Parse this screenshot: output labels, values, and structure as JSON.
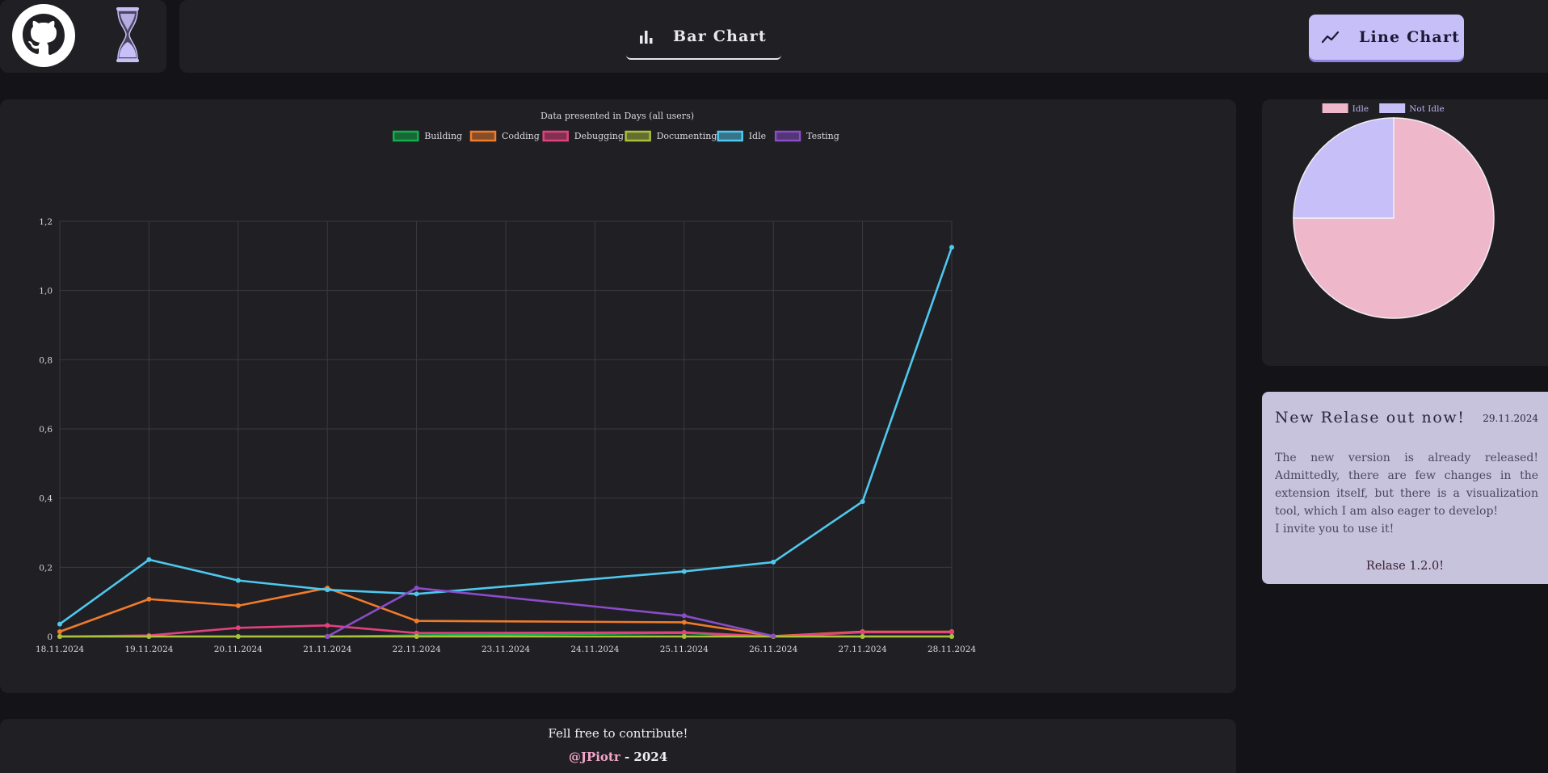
{
  "header": {
    "github_icon": "github-icon",
    "hourglass_icon": "hourglass-icon",
    "tabs": [
      {
        "label": "Bar Chart",
        "icon": "bar-chart-icon",
        "active": false
      },
      {
        "label": "Line Chart",
        "icon": "line-chart-icon",
        "active": true
      }
    ]
  },
  "colors": {
    "building": "#10b04a",
    "codding": "#f07b2a",
    "debugging": "#e2417e",
    "documenting": "#a9c03a",
    "idle": "#4fc8ee",
    "testing": "#8a4cc8",
    "pie_idle": "#eeb8ca",
    "pie_not_idle": "#c7bff8",
    "accent": "#c7bff8"
  },
  "chart_data": [
    {
      "type": "line",
      "title": "Data presented in Days (all users)",
      "categories": [
        "18.11.2024",
        "19.11.2024",
        "20.11.2024",
        "21.11.2024",
        "22.11.2024",
        "23.11.2024",
        "24.11.2024",
        "25.11.2024",
        "26.11.2024",
        "27.11.2024",
        "28.11.2024"
      ],
      "ylim": [
        0,
        1.2
      ],
      "yticks": [
        "0",
        "0,2",
        "0,4",
        "0,6",
        "0,8",
        "1,0",
        "1,2"
      ],
      "grid": true,
      "legend_position": "top",
      "series": [
        {
          "name": "Building",
          "color": "#10b04a",
          "points": [
            [
              0,
              0
            ],
            [
              1,
              0
            ],
            [
              2,
              0
            ],
            [
              3,
              0
            ],
            [
              4,
              0.003
            ],
            [
              7,
              0.01
            ],
            [
              8,
              0
            ],
            [
              9,
              0
            ],
            [
              10,
              0
            ]
          ]
        },
        {
          "name": "Codding",
          "color": "#f07b2a",
          "points": [
            [
              0,
              0.014
            ],
            [
              1,
              0.108
            ],
            [
              2,
              0.089
            ],
            [
              3,
              0.14
            ],
            [
              4,
              0.045
            ],
            [
              7,
              0.041
            ],
            [
              8,
              0.001
            ],
            [
              9,
              0.014
            ],
            [
              10,
              0.014
            ]
          ]
        },
        {
          "name": "Debugging",
          "color": "#e2417e",
          "points": [
            [
              0,
              0
            ],
            [
              1,
              0.003
            ],
            [
              2,
              0.025
            ],
            [
              3,
              0.032
            ],
            [
              4,
              0.01
            ],
            [
              7,
              0.012
            ],
            [
              8,
              0
            ],
            [
              9,
              0.012
            ],
            [
              10,
              0.012
            ]
          ]
        },
        {
          "name": "Documenting",
          "color": "#a9c03a",
          "points": [
            [
              0,
              0
            ],
            [
              1,
              0
            ],
            [
              2,
              0
            ],
            [
              3,
              0
            ],
            [
              4,
              0
            ],
            [
              7,
              0
            ],
            [
              8,
              0
            ],
            [
              9,
              0
            ],
            [
              10,
              0
            ]
          ]
        },
        {
          "name": "Idle",
          "color": "#4fc8ee",
          "points": [
            [
              0,
              0.036
            ],
            [
              1,
              0.222
            ],
            [
              2,
              0.162
            ],
            [
              3,
              0.135
            ],
            [
              4,
              0.123
            ],
            [
              7,
              0.188
            ],
            [
              8,
              0.215
            ],
            [
              9,
              0.39
            ],
            [
              10,
              1.125
            ]
          ]
        },
        {
          "name": "Testing",
          "color": "#8a4cc8",
          "points": [
            [
              3,
              0
            ],
            [
              4,
              0.14
            ],
            [
              7,
              0.06
            ],
            [
              8,
              0.001
            ]
          ]
        }
      ]
    },
    {
      "type": "pie",
      "labels": [
        "Idle",
        "Not Idle"
      ],
      "values": [
        75,
        25
      ],
      "colors": [
        "#eeb8ca",
        "#c7bff8"
      ],
      "legend_position": "top"
    }
  ],
  "release": {
    "title": "New Relase out now!",
    "date": "29.11.2024",
    "body_line1": "The new version is already released! Admittedly, there are few changes in the extension itself, but there is a visualization tool, which I am also eager to develop!",
    "body_line2": "I invite you to use it!",
    "link": "Relase 1.2.0!"
  },
  "footer": {
    "text": "Fell free to contribute!",
    "author": "@JPiotr",
    "year_suffix": " - 2024"
  }
}
